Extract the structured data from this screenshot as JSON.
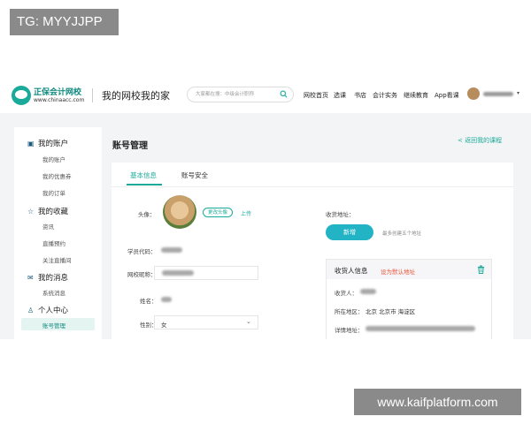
{
  "watermarks": {
    "top_left": "TG: MYYJJPP",
    "bottom_right": "www.kaifplatform.com"
  },
  "header": {
    "brand": "正保会计网校",
    "domain": "www.chinaacc.com",
    "slogan": "我的网校我的家",
    "search_placeholder": "大家都在搜：中级会计职称",
    "nav": [
      "网校首页",
      "选课",
      "书店",
      "会计实务",
      "继续教育",
      "App看课"
    ]
  },
  "sidebar": {
    "groups": [
      {
        "label": "我的账户",
        "icon": "wallet-icon",
        "items": [
          "我的账户",
          "我的优惠券",
          "我的订单"
        ]
      },
      {
        "label": "我的收藏",
        "icon": "star-icon",
        "items": [
          "资讯",
          "直播预约",
          "关注直播间"
        ]
      },
      {
        "label": "我的消息",
        "icon": "mail-icon",
        "items": [
          "系统消息"
        ]
      },
      {
        "label": "个人中心",
        "icon": "user-icon",
        "items": [
          "账号管理"
        ]
      }
    ],
    "active_item": "账号管理"
  },
  "page": {
    "title": "账号管理",
    "back_link": "< 返回我的课程"
  },
  "tabs": [
    "基本信息",
    "账号安全"
  ],
  "profile": {
    "avatar_label": "头像：",
    "change_avatar": "更改头像",
    "upload": "上传",
    "student_code_label": "学员代码：",
    "nickname_label": "网校昵称：",
    "name_label": "姓名：",
    "gender_label": "性别：",
    "gender_value": "女"
  },
  "address": {
    "label": "收货地址：",
    "new_button": "新增",
    "hint": "最多创建五个地址",
    "card_title": "收货人信息",
    "set_default": "设为默认地址",
    "recipient_label": "收货人：",
    "region_label": "所在地区：",
    "region_value": "北京 北京市 海淀区",
    "detail_label": "详情地址："
  },
  "colors": {
    "accent": "#1aaa99",
    "button": "#22b4c4",
    "warning": "#e8553a"
  }
}
